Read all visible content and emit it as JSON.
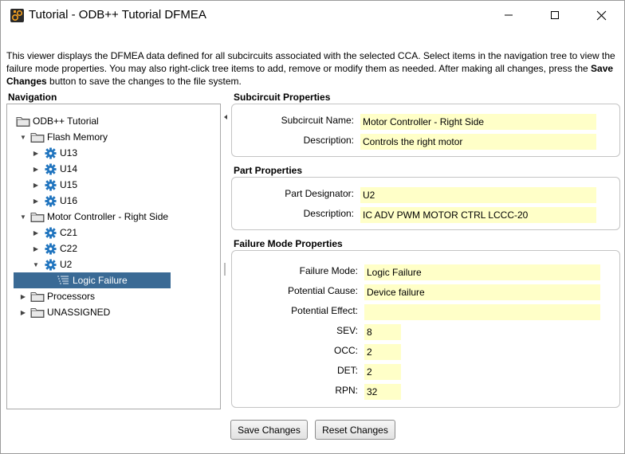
{
  "window": {
    "title": "Tutorial - ODB++ Tutorial DFMEA"
  },
  "description": {
    "part1": "This viewer displays the DFMEA data defined for all subcircuits associated with the selected CCA. Select items in the navigation tree to view the failure mode properties. You may also right-click tree items to add, remove or modify them as needed. After making all changes, press the ",
    "bold1": "Save Changes",
    "part2": " button to save the changes to the file system."
  },
  "navigation": {
    "title": "Navigation",
    "items": [
      {
        "label": "ODB++ Tutorial",
        "icon": "folder-icon",
        "expander": ""
      },
      {
        "label": "Flash Memory",
        "icon": "folder-icon",
        "expander": "expanded"
      },
      {
        "label": "U13",
        "icon": "gear-icon",
        "expander": "collapsed"
      },
      {
        "label": "U14",
        "icon": "gear-icon",
        "expander": "collapsed"
      },
      {
        "label": "U15",
        "icon": "gear-icon",
        "expander": "collapsed"
      },
      {
        "label": "U16",
        "icon": "gear-icon",
        "expander": "collapsed"
      },
      {
        "label": "Motor Controller - Right Side",
        "icon": "folder-icon",
        "expander": "expanded"
      },
      {
        "label": "C21",
        "icon": "gear-icon",
        "expander": "collapsed"
      },
      {
        "label": "C22",
        "icon": "gear-icon",
        "expander": "collapsed"
      },
      {
        "label": "U2",
        "icon": "gear-icon",
        "expander": "expanded"
      },
      {
        "label": "Logic Failure",
        "icon": "list-icon",
        "expander": "",
        "selected": true
      },
      {
        "label": "Processors",
        "icon": "folder-icon",
        "expander": "collapsed"
      },
      {
        "label": "UNASSIGNED",
        "icon": "folder-icon",
        "expander": "collapsed"
      }
    ]
  },
  "subcircuit": {
    "title": "Subcircuit Properties",
    "name_label": "Subcircuit Name:",
    "name_value": "Motor Controller - Right Side",
    "desc_label": "Description:",
    "desc_value": "Controls the right motor"
  },
  "part": {
    "title": "Part Properties",
    "designator_label": "Part Designator:",
    "designator_value": "U2",
    "desc_label": "Description:",
    "desc_value": "IC ADV PWM MOTOR CTRL LCCC-20"
  },
  "failure": {
    "title": "Failure Mode Properties",
    "mode_label": "Failure Mode:",
    "mode_value": "Logic Failure",
    "cause_label": "Potential Cause:",
    "cause_value": "Device failure",
    "effect_label": "Potential Effect:",
    "effect_value": "",
    "sev_label": "SEV:",
    "sev_value": "8",
    "occ_label": "OCC:",
    "occ_value": "2",
    "det_label": "DET:",
    "det_value": "2",
    "rpn_label": "RPN:",
    "rpn_value": "32"
  },
  "buttons": {
    "save": "Save Changes",
    "reset": "Reset Changes"
  },
  "colors": {
    "field_bg": "#ffffc8",
    "selection": "#3a6a95",
    "gear": "#1e73be",
    "folder": "#555555"
  }
}
